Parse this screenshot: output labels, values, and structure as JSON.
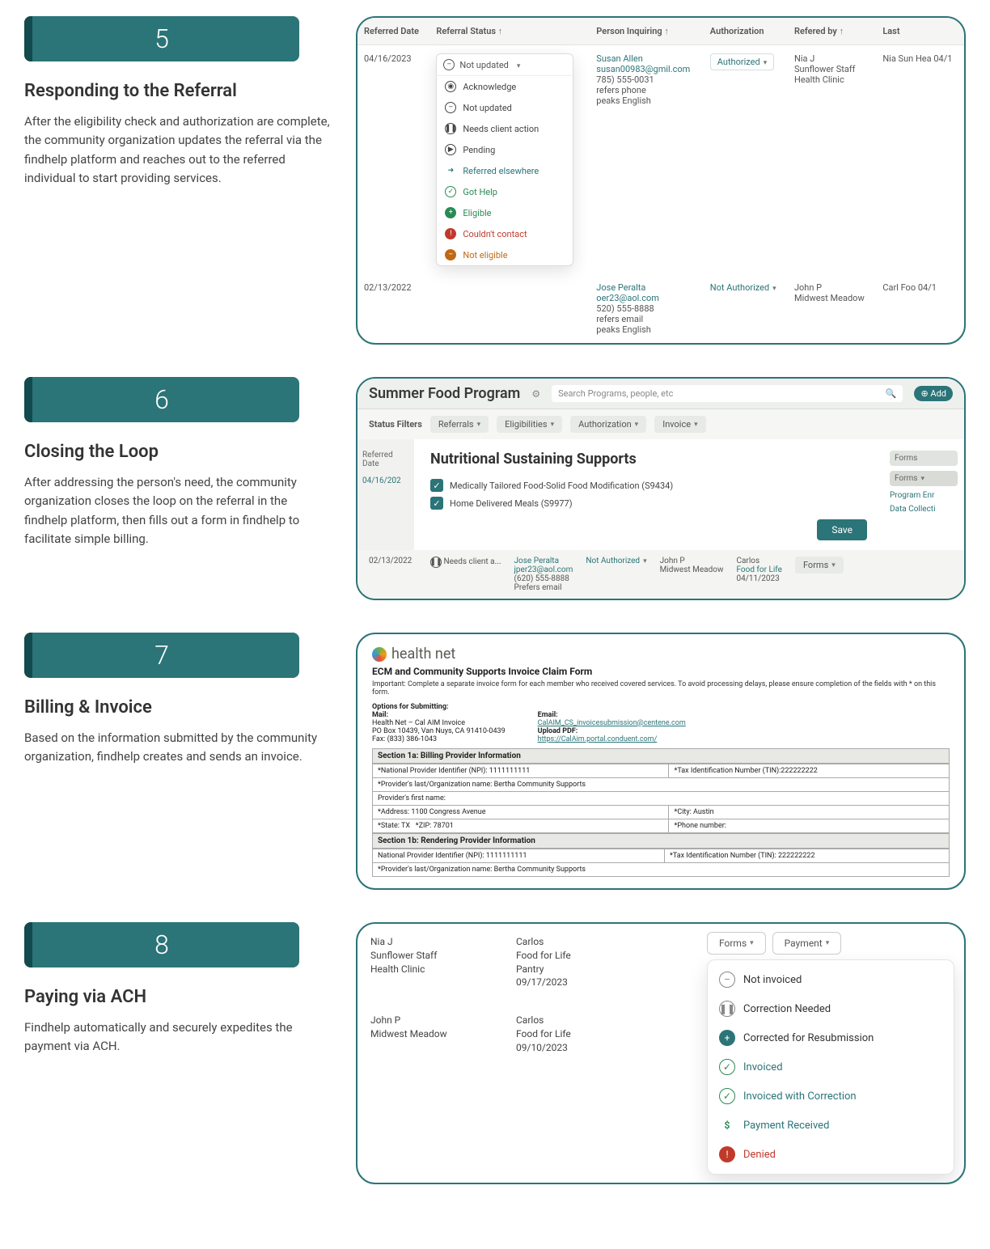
{
  "steps": {
    "s5": {
      "num": "5",
      "title": "Responding to the Referral",
      "body": "After the eligibility check and authorization are complete, the community organization updates the referral via the findhelp platform and reaches out to the referred individual to start providing services."
    },
    "s6": {
      "num": "6",
      "title": "Closing the Loop",
      "body": "After addressing the person's need, the community organization closes the loop on the referral in the findhelp platform, then fills out a form in findhelp to facilitate simple billing."
    },
    "s7": {
      "num": "7",
      "title": "Billing & Invoice",
      "body": "Based on the information submitted by the community organization, findhelp creates and sends an invoice."
    },
    "s8": {
      "num": "8",
      "title": "Paying via ACH",
      "body": "Findhelp automatically and securely expedites the payment via ACH."
    }
  },
  "panel5": {
    "cols": {
      "c1": "Referred Date",
      "c2": "Referral Status",
      "c3": "Person Inquiring",
      "c4": "Authorization",
      "c5": "Refered by",
      "c6": "Last"
    },
    "row1": {
      "date": "04/16/2023",
      "status_head": "Not updated",
      "opts": [
        "Acknowledge",
        "Not updated",
        "Needs client action",
        "Pending",
        "Referred elsewhere",
        "Got Help",
        "Eligible",
        "Couldn't contact",
        "Not eligible"
      ],
      "person_name": "Susan Allen",
      "person_email": "susan00983@gmil.com",
      "person_phone": "785) 555-0031",
      "person_pref": "refers phone",
      "person_lang": "peaks English",
      "auth": "Authorized",
      "by1": "Nia J",
      "by2": "Sunflower Staff",
      "by3": "Health Clinic",
      "last": "Nia Sun Hea 04/1"
    },
    "row2": {
      "date": "02/13/2022",
      "person_name": "Jose Peralta",
      "person_email": "oer23@aol.com",
      "person_phone": "520) 555-8888",
      "person_pref": "refers email",
      "person_lang": "peaks English",
      "auth": "Not Authorized",
      "by1": "John P",
      "by2": "Midwest Meadow",
      "last": "Carl Foo 04/1"
    }
  },
  "panel6": {
    "program": "Summer Food Program",
    "search_ph": "Search Programs, people, etc",
    "add": "Add",
    "filters_label": "Status Filters",
    "chips": [
      "Referrals",
      "Eligibilities",
      "Authorization",
      "Invoice"
    ],
    "side_head": "Referred Date",
    "side_date": "04/16/202",
    "card_title": "Nutritional Sustaining Supports",
    "line1": "Medically Tailored Food-Solid Food Modification (S9434)",
    "line2": "Home Delivered Meals (S9977)",
    "save": "Save",
    "right_forms": "Forms",
    "right_btn": "Forms",
    "right_l1": "Program Enr",
    "right_l2": "Data Collecti",
    "row2": {
      "date": "02/13/2022",
      "status": "Needs client a...",
      "name": "Jose Peralta",
      "email": "jper23@aol.com",
      "phone": "(620) 555-8888",
      "pref": "Prefers email",
      "auth": "Not Authorized",
      "by": "John P",
      "by2": "Midwest Meadow",
      "upd": "Carlos",
      "upd2": "Food for Life",
      "upd3": "04/11/2023",
      "formsbtn": "Forms"
    }
  },
  "panel7": {
    "brand": "health net",
    "title": "ECM and Community Supports Invoice Claim Form",
    "note": "Important: Complete a separate invoice form for each member who received covered services. To avoid processing delays, please ensure completion of the fields with * on this form.",
    "opts_head": "Options for Submitting:",
    "mail_h": "Mail:",
    "mail1": "Health Net – Cal AIM Invoice",
    "mail2": "PO Box 10439, Van Nuys, CA 91410-0439",
    "fax": "Fax: (833) 386-1043",
    "email_h": "Email:",
    "email_v": "CalAIM_CS_invoicesubmission@centene.com",
    "upload_h": "Upload PDF:",
    "upload_v": "https://CalAim.portal.conduent.com/",
    "sec1": "Section 1a: Billing Provider Information",
    "npi": "*National Provider Identifier (NPI): 1111111111",
    "tin": "*Tax Identification Number (TIN):222222222",
    "org": "*Provider's last/Organization name: Bertha Community Supports",
    "first": "Provider's first name:",
    "addr": "*Address: 1100 Congress Avenue",
    "city": "*City: Austin",
    "state": "*State: TX",
    "zip": "*ZIP: 78701",
    "phone": "*Phone number:",
    "sec2": "Section 1b: Rendering Provider Information",
    "npi2": "National Provider Identifier (NPI):  1111111111",
    "tin2": "*Tax Identification Number (TIN): 222222222",
    "org2": "*Provider's last/Organization name: Bertha Community Supports"
  },
  "panel8": {
    "r1a": "Nia J",
    "r1b": "Sunflower Staff",
    "r1c": "Health Clinic",
    "r1d": "Carlos",
    "r1e": "Food for Life",
    "r1f": "Pantry",
    "r1g": "09/17/2023",
    "r2a": "John P",
    "r2b": "Midwest Meadow",
    "r2d": "Carlos",
    "r2e": "Food for Life",
    "r2g": "09/10/2023",
    "btn_forms": "Forms",
    "btn_payment": "Payment",
    "opts": [
      "Not invoiced",
      "Correction Needed",
      "Corrected for Resubmission",
      "Invoiced",
      "Invoiced with Correction",
      "Payment Received",
      "Denied"
    ]
  }
}
